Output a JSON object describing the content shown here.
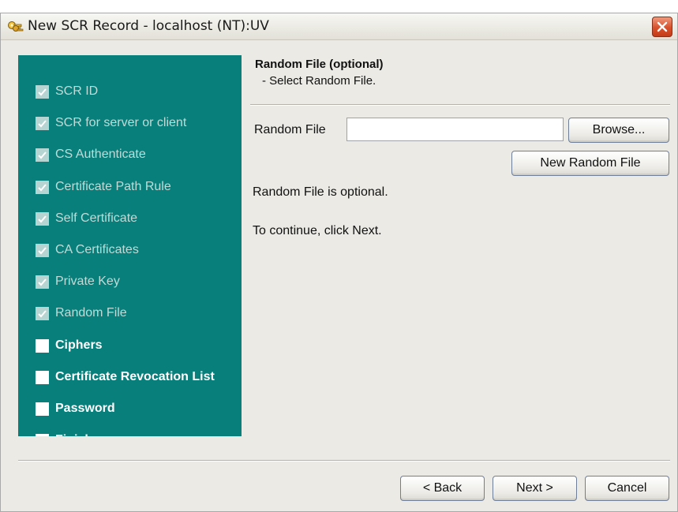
{
  "window": {
    "title": "New SCR Record - localhost (NT):UV",
    "icons": {
      "app": "keys-icon",
      "close": "close-icon"
    }
  },
  "steps": [
    {
      "label": "SCR ID",
      "completed": true
    },
    {
      "label": "SCR for server or client",
      "completed": true
    },
    {
      "label": "CS Authenticate",
      "completed": true
    },
    {
      "label": "Certificate Path Rule",
      "completed": true
    },
    {
      "label": "Self Certificate",
      "completed": true
    },
    {
      "label": "CA Certificates",
      "completed": true
    },
    {
      "label": "Private Key",
      "completed": true
    },
    {
      "label": "Random File",
      "completed": true
    },
    {
      "label": "Ciphers",
      "completed": false
    },
    {
      "label": "Certificate Revocation List",
      "completed": false
    },
    {
      "label": "Password",
      "completed": false
    },
    {
      "label": "Finish",
      "completed": false
    }
  ],
  "content": {
    "heading": "Random File (optional)",
    "subheading": "- Select Random File.",
    "random_file_label": "Random File",
    "random_file_value": "",
    "browse_label": "Browse...",
    "new_random_file_label": "New Random File",
    "info_optional": "Random File is optional.",
    "info_continue": "To continue, click Next."
  },
  "footer": {
    "back_label": "< Back",
    "next_label": "Next >",
    "cancel_label": "Cancel"
  },
  "colors": {
    "panel": "#087f7a",
    "window": "#ebeae5",
    "close_button": "#d7502c"
  }
}
